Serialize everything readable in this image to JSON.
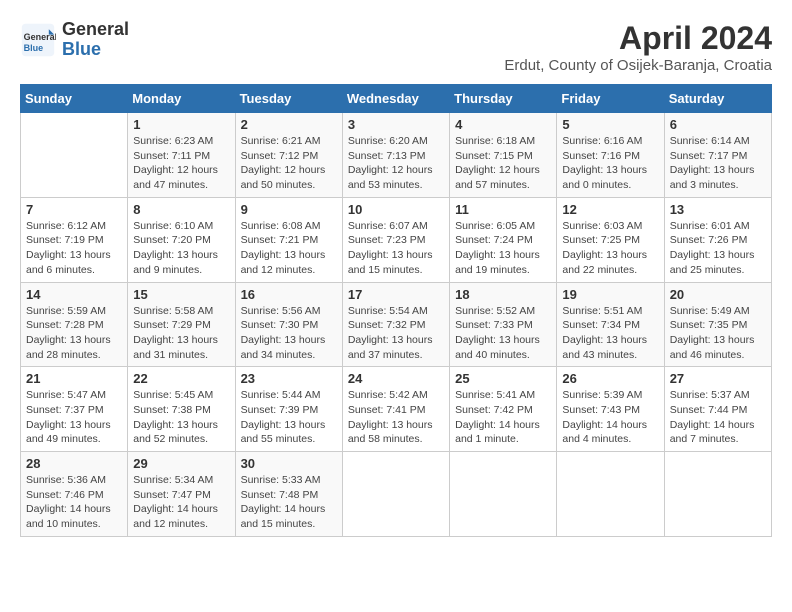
{
  "header": {
    "logo_line1": "General",
    "logo_line2": "Blue",
    "month_title": "April 2024",
    "subtitle": "Erdut, County of Osijek-Baranja, Croatia"
  },
  "days_of_week": [
    "Sunday",
    "Monday",
    "Tuesday",
    "Wednesday",
    "Thursday",
    "Friday",
    "Saturday"
  ],
  "weeks": [
    [
      {
        "day": "",
        "info": ""
      },
      {
        "day": "1",
        "info": "Sunrise: 6:23 AM\nSunset: 7:11 PM\nDaylight: 12 hours\nand 47 minutes."
      },
      {
        "day": "2",
        "info": "Sunrise: 6:21 AM\nSunset: 7:12 PM\nDaylight: 12 hours\nand 50 minutes."
      },
      {
        "day": "3",
        "info": "Sunrise: 6:20 AM\nSunset: 7:13 PM\nDaylight: 12 hours\nand 53 minutes."
      },
      {
        "day": "4",
        "info": "Sunrise: 6:18 AM\nSunset: 7:15 PM\nDaylight: 12 hours\nand 57 minutes."
      },
      {
        "day": "5",
        "info": "Sunrise: 6:16 AM\nSunset: 7:16 PM\nDaylight: 13 hours\nand 0 minutes."
      },
      {
        "day": "6",
        "info": "Sunrise: 6:14 AM\nSunset: 7:17 PM\nDaylight: 13 hours\nand 3 minutes."
      }
    ],
    [
      {
        "day": "7",
        "info": "Sunrise: 6:12 AM\nSunset: 7:19 PM\nDaylight: 13 hours\nand 6 minutes."
      },
      {
        "day": "8",
        "info": "Sunrise: 6:10 AM\nSunset: 7:20 PM\nDaylight: 13 hours\nand 9 minutes."
      },
      {
        "day": "9",
        "info": "Sunrise: 6:08 AM\nSunset: 7:21 PM\nDaylight: 13 hours\nand 12 minutes."
      },
      {
        "day": "10",
        "info": "Sunrise: 6:07 AM\nSunset: 7:23 PM\nDaylight: 13 hours\nand 15 minutes."
      },
      {
        "day": "11",
        "info": "Sunrise: 6:05 AM\nSunset: 7:24 PM\nDaylight: 13 hours\nand 19 minutes."
      },
      {
        "day": "12",
        "info": "Sunrise: 6:03 AM\nSunset: 7:25 PM\nDaylight: 13 hours\nand 22 minutes."
      },
      {
        "day": "13",
        "info": "Sunrise: 6:01 AM\nSunset: 7:26 PM\nDaylight: 13 hours\nand 25 minutes."
      }
    ],
    [
      {
        "day": "14",
        "info": "Sunrise: 5:59 AM\nSunset: 7:28 PM\nDaylight: 13 hours\nand 28 minutes."
      },
      {
        "day": "15",
        "info": "Sunrise: 5:58 AM\nSunset: 7:29 PM\nDaylight: 13 hours\nand 31 minutes."
      },
      {
        "day": "16",
        "info": "Sunrise: 5:56 AM\nSunset: 7:30 PM\nDaylight: 13 hours\nand 34 minutes."
      },
      {
        "day": "17",
        "info": "Sunrise: 5:54 AM\nSunset: 7:32 PM\nDaylight: 13 hours\nand 37 minutes."
      },
      {
        "day": "18",
        "info": "Sunrise: 5:52 AM\nSunset: 7:33 PM\nDaylight: 13 hours\nand 40 minutes."
      },
      {
        "day": "19",
        "info": "Sunrise: 5:51 AM\nSunset: 7:34 PM\nDaylight: 13 hours\nand 43 minutes."
      },
      {
        "day": "20",
        "info": "Sunrise: 5:49 AM\nSunset: 7:35 PM\nDaylight: 13 hours\nand 46 minutes."
      }
    ],
    [
      {
        "day": "21",
        "info": "Sunrise: 5:47 AM\nSunset: 7:37 PM\nDaylight: 13 hours\nand 49 minutes."
      },
      {
        "day": "22",
        "info": "Sunrise: 5:45 AM\nSunset: 7:38 PM\nDaylight: 13 hours\nand 52 minutes."
      },
      {
        "day": "23",
        "info": "Sunrise: 5:44 AM\nSunset: 7:39 PM\nDaylight: 13 hours\nand 55 minutes."
      },
      {
        "day": "24",
        "info": "Sunrise: 5:42 AM\nSunset: 7:41 PM\nDaylight: 13 hours\nand 58 minutes."
      },
      {
        "day": "25",
        "info": "Sunrise: 5:41 AM\nSunset: 7:42 PM\nDaylight: 14 hours\nand 1 minute."
      },
      {
        "day": "26",
        "info": "Sunrise: 5:39 AM\nSunset: 7:43 PM\nDaylight: 14 hours\nand 4 minutes."
      },
      {
        "day": "27",
        "info": "Sunrise: 5:37 AM\nSunset: 7:44 PM\nDaylight: 14 hours\nand 7 minutes."
      }
    ],
    [
      {
        "day": "28",
        "info": "Sunrise: 5:36 AM\nSunset: 7:46 PM\nDaylight: 14 hours\nand 10 minutes."
      },
      {
        "day": "29",
        "info": "Sunrise: 5:34 AM\nSunset: 7:47 PM\nDaylight: 14 hours\nand 12 minutes."
      },
      {
        "day": "30",
        "info": "Sunrise: 5:33 AM\nSunset: 7:48 PM\nDaylight: 14 hours\nand 15 minutes."
      },
      {
        "day": "",
        "info": ""
      },
      {
        "day": "",
        "info": ""
      },
      {
        "day": "",
        "info": ""
      },
      {
        "day": "",
        "info": ""
      }
    ]
  ]
}
